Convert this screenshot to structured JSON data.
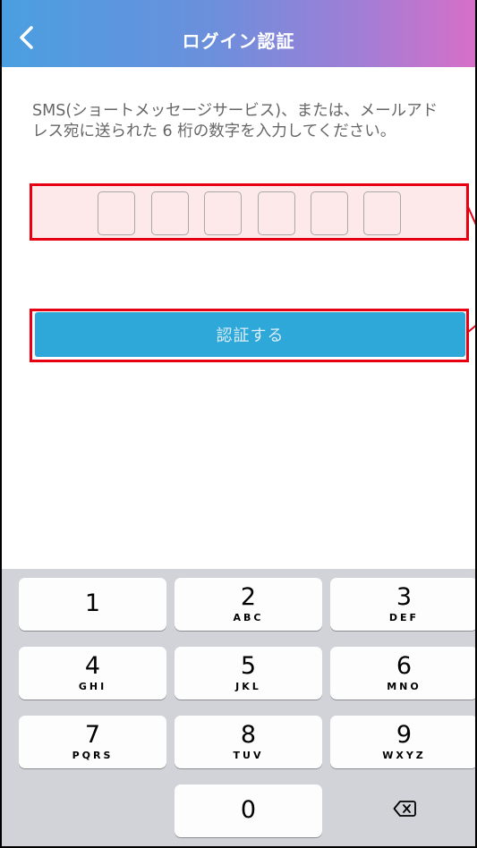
{
  "header": {
    "title": "ログイン認証",
    "back_icon": "chevron-left-icon"
  },
  "instruction": {
    "line1": "SMS(ショートメッセージサービス)、または、メールアド",
    "line2": "レス宛に送られた 6 桁の数字を入力してください。"
  },
  "code_input": {
    "digits": [
      "",
      "",
      "",
      "",
      "",
      ""
    ]
  },
  "submit": {
    "label": "認証する"
  },
  "keypad": {
    "keys": [
      {
        "digit": "1",
        "letters": ""
      },
      {
        "digit": "2",
        "letters": "ABC"
      },
      {
        "digit": "3",
        "letters": "DEF"
      },
      {
        "digit": "4",
        "letters": "GHI"
      },
      {
        "digit": "5",
        "letters": "JKL"
      },
      {
        "digit": "6",
        "letters": "MNO"
      },
      {
        "digit": "7",
        "letters": "PQRS"
      },
      {
        "digit": "8",
        "letters": "TUV"
      },
      {
        "digit": "9",
        "letters": "WXYZ"
      },
      {
        "digit": "0",
        "letters": ""
      }
    ],
    "delete_icon": "backspace-icon"
  },
  "colors": {
    "highlight": "#e60012",
    "button": "#2ea7d9",
    "keyboard_bg": "#d1d3d9"
  }
}
